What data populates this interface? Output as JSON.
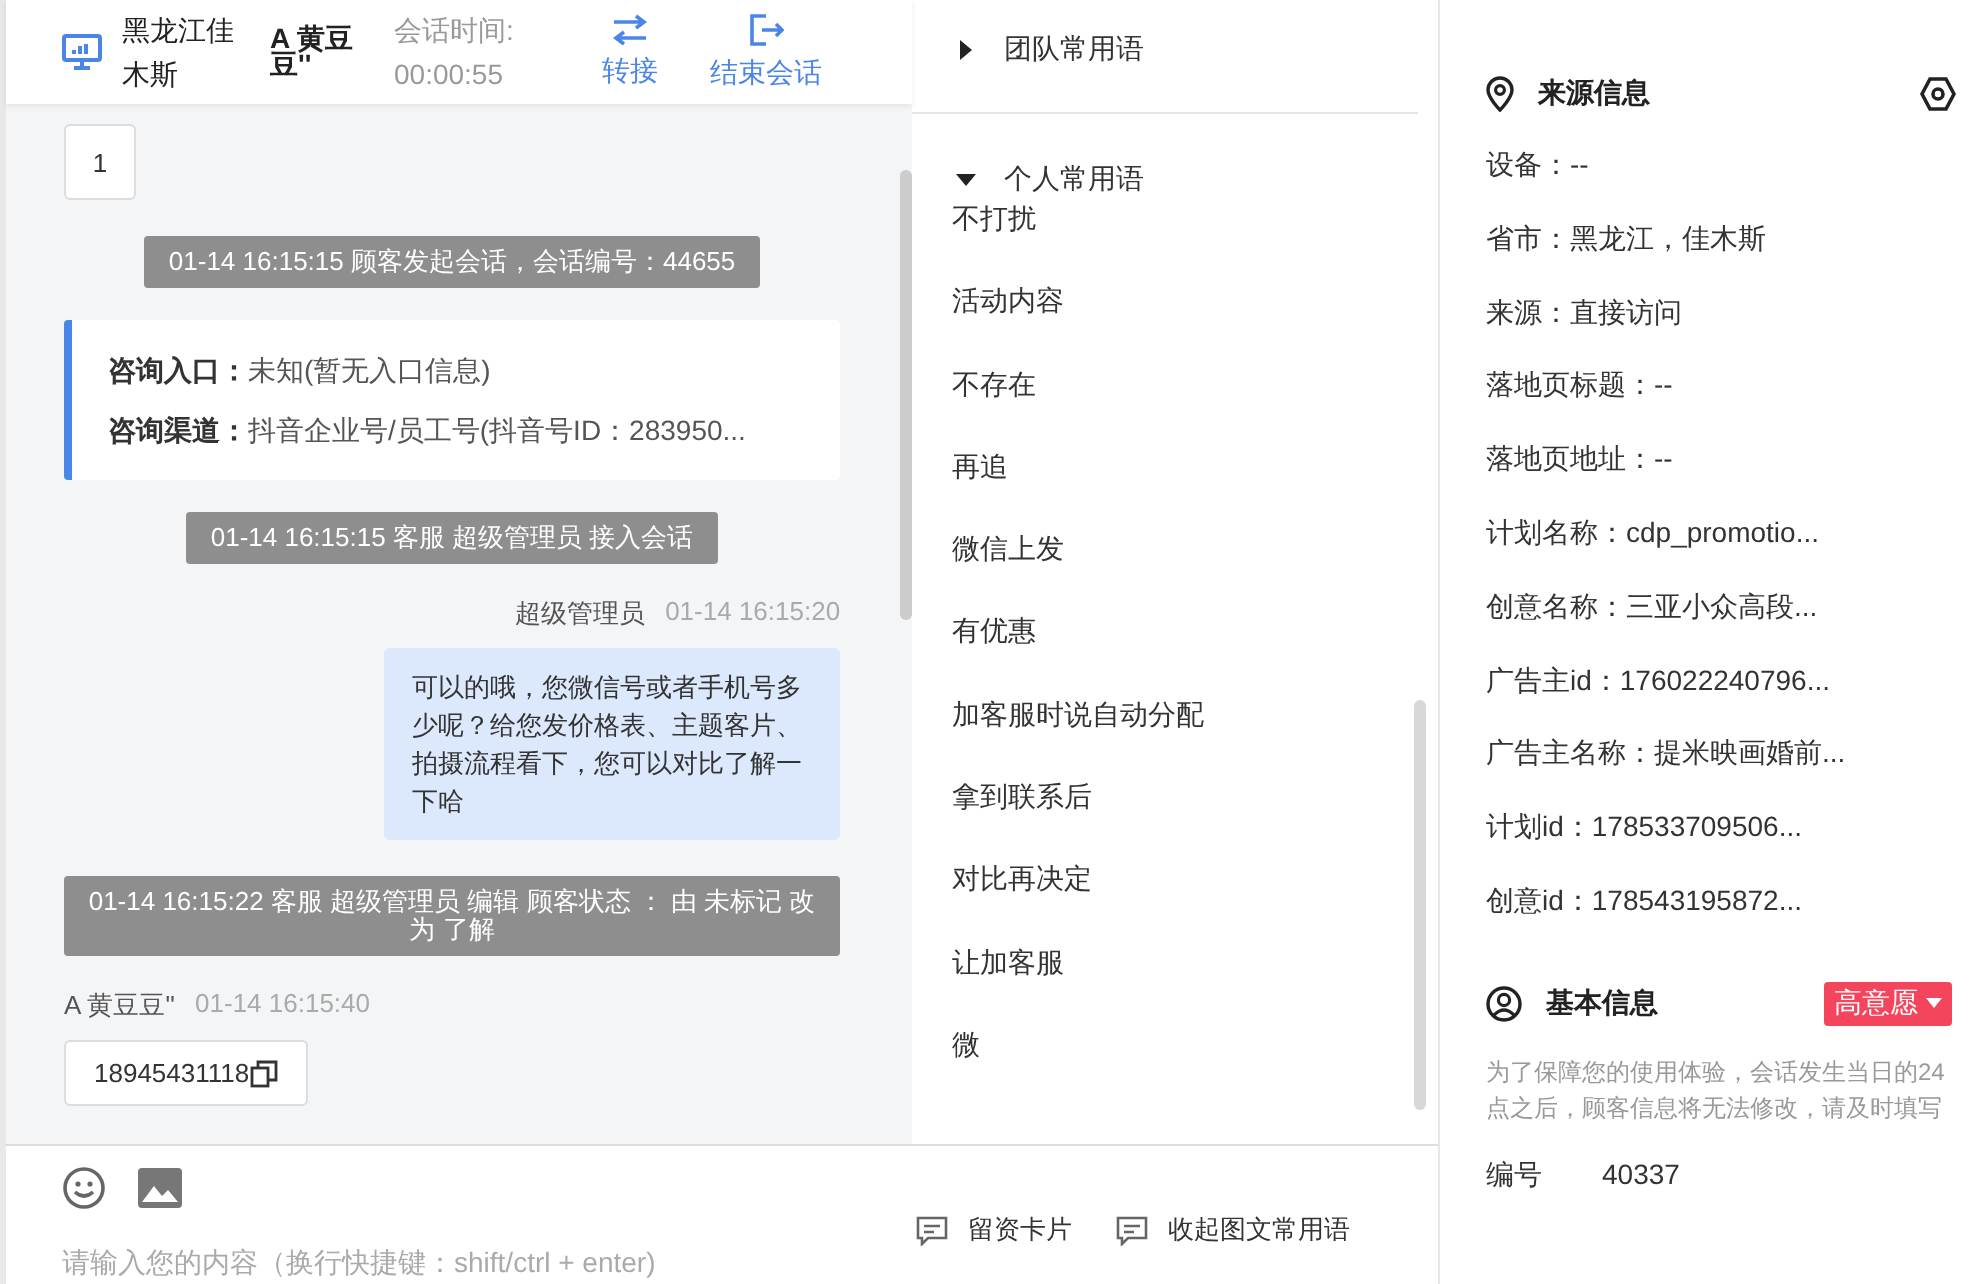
{
  "header": {
    "location": "黑龙江佳木斯",
    "customer": "A 黄豆豆''",
    "timer_label": "会话时间:",
    "timer": "00:00:55",
    "actions": [
      {
        "label": "转接",
        "kind": "transfer"
      },
      {
        "label": "结束会话",
        "kind": "end"
      }
    ]
  },
  "chat": {
    "page_badge": "1",
    "messages": [
      {
        "kind": "system",
        "text": "01-14 16:15:15 顾客发起会话，会话编号：44655"
      },
      {
        "kind": "entry",
        "lines": [
          {
            "label": "咨询入口：",
            "value": "未知(暂无入口信息)"
          },
          {
            "label": "咨询渠道：",
            "value": "抖音企业号/员工号(抖音号ID：283950..."
          }
        ]
      },
      {
        "kind": "system",
        "text": "01-14 16:15:15 客服 超级管理员 接入会话"
      },
      {
        "kind": "agent",
        "sender": "超级管理员",
        "time": "01-14 16:15:20",
        "text": "可以的哦，您微信号或者手机号多少呢？给您发价格表、主题客片、拍摄流程看下，您可以对比了解一下哈"
      },
      {
        "kind": "system",
        "text": "01-14 16:15:22 客服 超级管理员 编辑 顾客状态 ： 由 未标记 改为 了解"
      },
      {
        "kind": "customer",
        "sender": "A 黄豆豆''",
        "time": "01-14 16:15:40",
        "text": "18945431118"
      }
    ]
  },
  "composer": {
    "placeholder": "请输入您的内容（换行快捷键：shift/ctrl + enter)"
  },
  "phrases": {
    "groups": [
      {
        "title": "团队常用语",
        "expanded": false
      },
      {
        "title": "个人常用语",
        "expanded": true,
        "items": [
          "不打扰",
          "活动内容",
          "不存在",
          "再追",
          "微信上发",
          "有优惠",
          "加客服时说自动分配",
          "拿到联系后",
          "对比再决定",
          "让加客服",
          "微"
        ]
      }
    ],
    "buttons": [
      "留资卡片",
      "收起图文常用语"
    ]
  },
  "source_info": {
    "title": "来源信息",
    "rows": [
      "设备：--",
      "省市：黑龙江，佳木斯",
      "来源：直接访问",
      "落地页标题：--",
      "落地页地址：--",
      "计划名称：cdp_promotio...",
      "创意名称：三亚小众高段...",
      "广告主id：176022240796...",
      "广告主名称：提米映画婚前...",
      "计划id：178533709506...",
      "创意id：178543195872..."
    ]
  },
  "basic_info": {
    "title": "基本信息",
    "tag": "高意愿",
    "note": "为了保障您的使用体验，会话发生当日的24点之后，顾客信息将无法修改，请及时填写",
    "fields": [
      {
        "label": "编号",
        "value": "40337"
      }
    ]
  }
}
